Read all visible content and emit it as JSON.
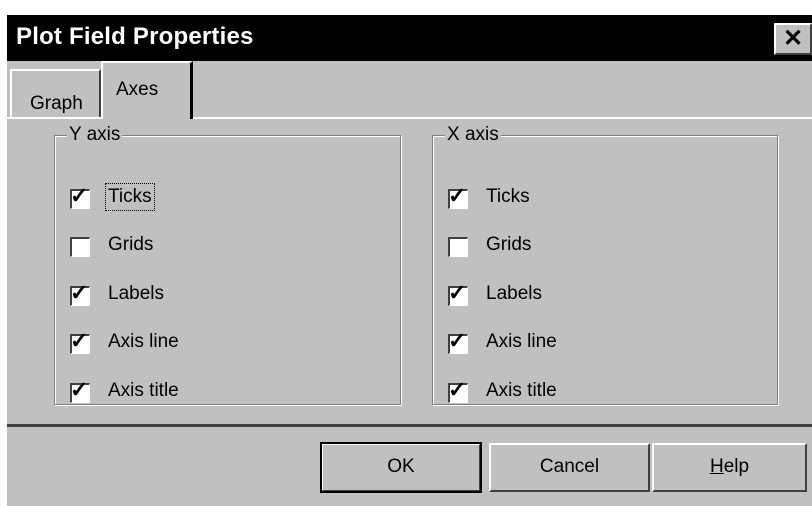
{
  "window": {
    "title": "Plot Field Properties",
    "close_label": "✕",
    "close_icon": "close-icon"
  },
  "tabs": [
    {
      "label": "Graph",
      "active": false
    },
    {
      "label": "Axes",
      "active": true
    }
  ],
  "y_axis": {
    "legend": "Y axis",
    "options": [
      {
        "label": "Ticks",
        "checked": true,
        "focused": true
      },
      {
        "label": "Grids",
        "checked": false
      },
      {
        "label": "Labels",
        "checked": true
      },
      {
        "label": "Axis line",
        "checked": true
      },
      {
        "label": "Axis title",
        "checked": true
      }
    ]
  },
  "x_axis": {
    "legend": "X axis",
    "options": [
      {
        "label": "Ticks",
        "checked": true
      },
      {
        "label": "Grids",
        "checked": false
      },
      {
        "label": "Labels",
        "checked": true
      },
      {
        "label": "Axis line",
        "checked": true
      },
      {
        "label": "Axis title",
        "checked": true
      }
    ]
  },
  "buttons": {
    "ok": "OK",
    "cancel": "Cancel",
    "help": "Help"
  },
  "colors": {
    "face": "#c0c0c0",
    "titlebar": "#000000",
    "highlight": "#ffffff",
    "shadow": "#404040"
  }
}
